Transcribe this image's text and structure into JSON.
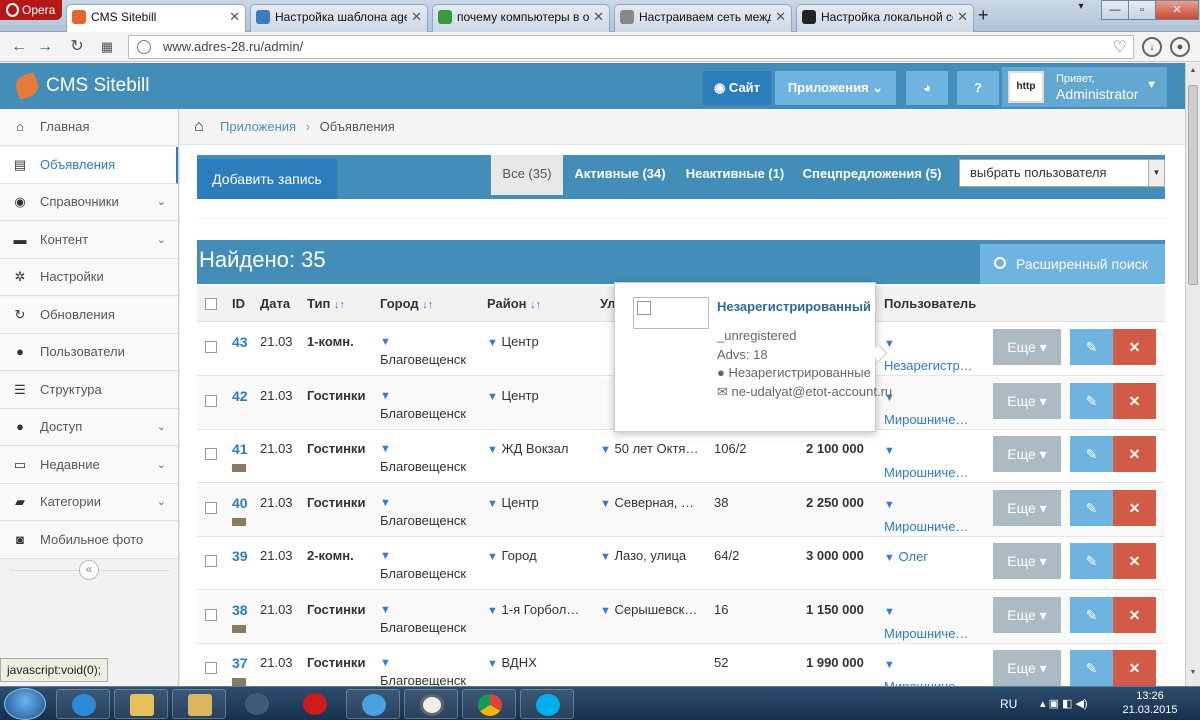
{
  "browser": {
    "menu_label": "Opera",
    "tabs": [
      {
        "title": "CMS Sitebill",
        "active": true,
        "fav_color": "#e8662a"
      },
      {
        "title": "Настройка шаблона agent",
        "active": false,
        "fav_color": "#3b7bbf"
      },
      {
        "title": "почему компьютеры в одн",
        "active": false,
        "fav_color": "#3a9a3a"
      },
      {
        "title": "Настраиваем сеть между",
        "active": false,
        "fav_color": "#888"
      },
      {
        "title": "Настройка локальной сети",
        "active": false,
        "fav_color": "#222"
      }
    ],
    "url": "www.adres-28.ru/admin/"
  },
  "header": {
    "brand": "CMS Sitebill",
    "site_label": "Сайт",
    "apps_label": "Приложения",
    "greeting": "Привет,",
    "username": "Administrator",
    "avatar_text": "http"
  },
  "sidebar": {
    "items": [
      {
        "label": "Главная",
        "icon": "home-icon",
        "glyph": "⌂",
        "active": false,
        "sub": false
      },
      {
        "label": "Объявления",
        "icon": "list-icon",
        "glyph": "▤",
        "active": true,
        "sub": false
      },
      {
        "label": "Справочники",
        "icon": "globe-icon",
        "glyph": "◉",
        "active": false,
        "sub": true
      },
      {
        "label": "Контент",
        "icon": "keyboard-icon",
        "glyph": "▬",
        "active": false,
        "sub": true
      },
      {
        "label": "Настройки",
        "icon": "gear-icon",
        "glyph": "✲",
        "active": false,
        "sub": false
      },
      {
        "label": "Обновления",
        "icon": "refresh-icon",
        "glyph": "↻",
        "active": false,
        "sub": false
      },
      {
        "label": "Пользователи",
        "icon": "user-icon",
        "glyph": "●",
        "active": false,
        "sub": false
      },
      {
        "label": "Структура",
        "icon": "structure-icon",
        "glyph": "☰",
        "active": false,
        "sub": false
      },
      {
        "label": "Доступ",
        "icon": "users-icon",
        "glyph": "●",
        "active": false,
        "sub": true
      },
      {
        "label": "Недавние",
        "icon": "monitor-icon",
        "glyph": "▭",
        "active": false,
        "sub": true
      },
      {
        "label": "Категории",
        "icon": "folder-icon",
        "glyph": "▰",
        "active": false,
        "sub": true
      },
      {
        "label": "Мобильное фото",
        "icon": "camera-icon",
        "glyph": "◙",
        "active": false,
        "sub": false
      }
    ]
  },
  "breadcrumb": {
    "parent": "Приложения",
    "current": "Объявления"
  },
  "actions": {
    "add_label": "Добавить запись",
    "filters": [
      {
        "label": "Все (35)",
        "active": true
      },
      {
        "label": "Активные (34)",
        "active": false
      },
      {
        "label": "Неактивные (1)",
        "active": false
      },
      {
        "label": "Спецпредложения (5)",
        "active": false
      }
    ],
    "user_select": "выбрать пользователя"
  },
  "results": {
    "found_label": "Найдено: 35",
    "advanced_search": "Расширенный поиск"
  },
  "table": {
    "columns": [
      "ID",
      "Дата",
      "Тип",
      "Город",
      "Район",
      "Ул",
      "Пользователь"
    ],
    "more_label": "Еще",
    "rows": [
      {
        "id": "43",
        "date": "21.03",
        "type": "1-комн.",
        "city": "Благовещенск",
        "district": "Центр",
        "street": "",
        "num": "",
        "price": "",
        "user": "Незарегистр…",
        "thumb": false
      },
      {
        "id": "42",
        "date": "21.03",
        "type": "Гостинки",
        "city": "Благовещенск",
        "district": "Центр",
        "street": "",
        "num": "",
        "price": "",
        "user": "Мирошниче…",
        "thumb": false
      },
      {
        "id": "41",
        "date": "21.03",
        "type": "Гостинки",
        "city": "Благовещенск",
        "district": "ЖД Вокзал",
        "street": "50 лет Октя…",
        "num": "106/2",
        "price": "2 100 000",
        "user": "Мирошниче…",
        "thumb": true
      },
      {
        "id": "40",
        "date": "21.03",
        "type": "Гостинки",
        "city": "Благовещенск",
        "district": "Центр",
        "street": "Северная, …",
        "num": "38",
        "price": "2 250 000",
        "user": "Мирошниче…",
        "thumb": true
      },
      {
        "id": "39",
        "date": "21.03",
        "type": "2-комн.",
        "city": "Благовещенск",
        "district": "Город",
        "street": "Лазо, улица",
        "num": "64/2",
        "price": "3 000 000",
        "user": "Олег",
        "thumb": false
      },
      {
        "id": "38",
        "date": "21.03",
        "type": "Гостинки",
        "city": "Благовещенск",
        "district": "1-я Горбол…",
        "street": "Серышевск…",
        "num": "16",
        "price": "1 150 000",
        "user": "Мирошниче…",
        "thumb": true
      },
      {
        "id": "37",
        "date": "21.03",
        "type": "Гостинки",
        "city": "Благовещенск",
        "district": "ВДНХ",
        "street": "",
        "num": "52",
        "price": "1 990 000",
        "user": "Мирошниче…",
        "thumb": true
      }
    ]
  },
  "popover": {
    "title": "Незарегистрированный",
    "login": "_unregistered",
    "advs": "Advs: 18",
    "name": "Незарегистрированные",
    "email": "ne-udalyat@etot-account.ru"
  },
  "status_text": "javascript:void(0);",
  "taskbar": {
    "lang": "RU",
    "time": "13:26",
    "date": "21.03.2015"
  }
}
